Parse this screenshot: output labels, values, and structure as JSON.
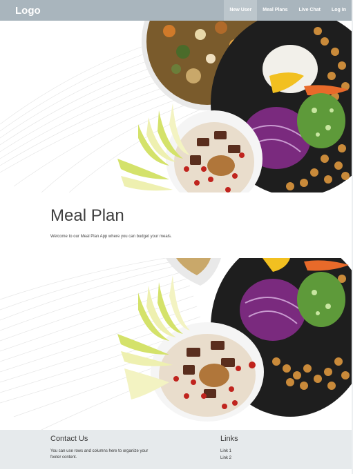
{
  "navbar": {
    "logo": "Logo",
    "items": [
      {
        "label": "New User",
        "active": true
      },
      {
        "label": "Meal Plans",
        "active": false
      },
      {
        "label": "Live Chat",
        "active": false
      },
      {
        "label": "Log In",
        "active": false
      }
    ],
    "background": "#a9b5bd"
  },
  "intro": {
    "title": "Meal Plan",
    "subtitle": "Welcome to our Meal Plan App where you can budget your meals."
  },
  "footer": {
    "contact_title": "Contact Us",
    "contact_text_line1": "You can use rows and columns here to organize your",
    "contact_text_line2": "footer content.",
    "links_title": "Links",
    "links": [
      "Link 1",
      "Link 2"
    ],
    "background": "#e6eaec"
  }
}
